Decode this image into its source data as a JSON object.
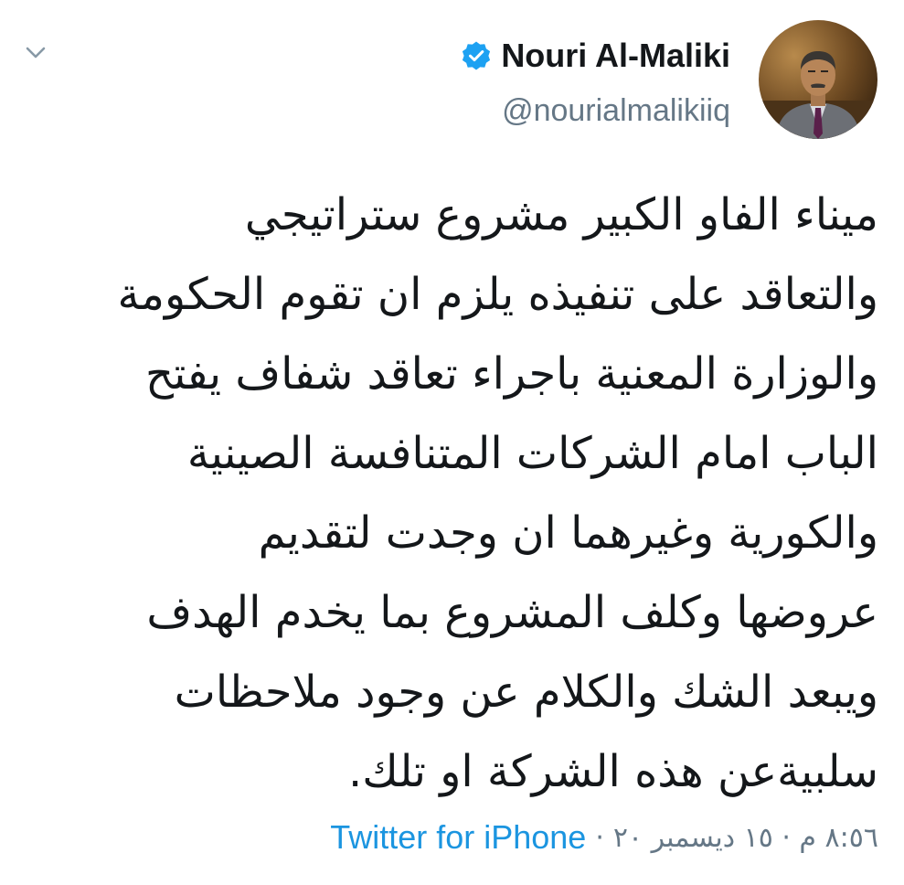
{
  "user": {
    "display_name": "Nouri Al-Maliki",
    "handle": "@nourialmalikiiq",
    "verified": true,
    "avatar_icon": "profile-photo"
  },
  "header": {
    "menu_icon": "chevron-down-icon"
  },
  "tweet": {
    "lines": [
      "ميناء الفاو الكبير مشروع ستراتيجي",
      "والتعاقد على تنفيذه يلزم ان تقوم الحكومة",
      "والوزارة المعنية باجراء تعاقد شفاف يفتح",
      "الباب امام الشركات المتنافسة الصينية",
      "والكورية وغيرهما ان وجدت لتقديم",
      "عروضها وكلف المشروع بما يخدم الهدف",
      "ويبعد الشك والكلام عن وجود ملاحظات",
      "سلبيةعن هذه الشركة او تلك."
    ],
    "timestamp": "٨:٥٦ م · ١٥ ديسمبر ٢٠",
    "separator": "·",
    "source": "Twitter for iPhone"
  },
  "colors": {
    "verified_blue": "#1da1f2",
    "link_blue": "#1b95e0",
    "secondary_gray": "#657786",
    "text": "#14171a"
  }
}
